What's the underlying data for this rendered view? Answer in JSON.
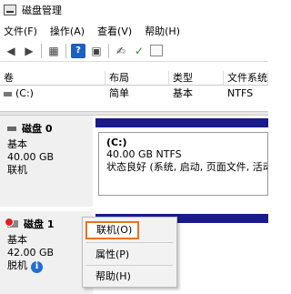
{
  "window": {
    "title": "磁盘管理"
  },
  "menu": [
    "文件(F)",
    "操作(A)",
    "查看(V)",
    "帮助(H)"
  ],
  "table": {
    "headers": [
      "卷",
      "布局",
      "类型",
      "文件系统"
    ],
    "rows": [
      {
        "volume": "(C:)",
        "layout": "简单",
        "type": "基本",
        "fs": "NTFS"
      }
    ]
  },
  "disks": [
    {
      "name": "磁盘 0",
      "type": "基本",
      "size": "40.00 GB",
      "status": "联机",
      "partition": {
        "name": "(C:)",
        "size_fs": "40.00 GB NTFS",
        "status": "状态良好 (系统, 启动, 页面文件, 活动, 故"
      }
    },
    {
      "name": "磁盘 1",
      "type": "基本",
      "size": "42.00 GB",
      "status": "脱机"
    }
  ],
  "context_menu": {
    "online": "联机(O)",
    "properties": "属性(P)",
    "help": "帮助(H)"
  },
  "colors": {
    "unallocated_bar": "#1a1a8c",
    "highlight_border": "#e8731a",
    "info": "#1f6fd0"
  }
}
